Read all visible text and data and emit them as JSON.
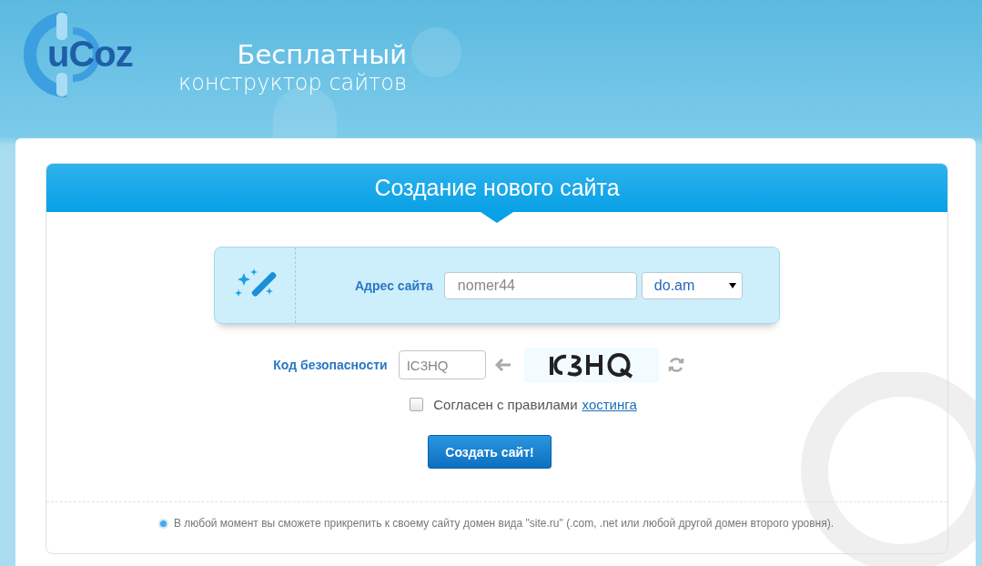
{
  "header": {
    "logo": "uCoz",
    "tagline_1": "Бесплатный",
    "tagline_2": "конструктор сайтов"
  },
  "card": {
    "title": "Создание нового сайта"
  },
  "address": {
    "label": "Адрес сайта",
    "value": "nomer44",
    "domain": "do.am"
  },
  "captcha": {
    "label": "Код безопасности",
    "value": "IC3HQ"
  },
  "agreement": {
    "checked": false,
    "text": "Согласен с правилами",
    "link": "хостинга"
  },
  "submit": "Создать сайт!",
  "note": "В любой момент вы сможете прикрепить к своему сайту домен вида \"site.ru\" (.com, .net или любой другой домен второго уровня)."
}
